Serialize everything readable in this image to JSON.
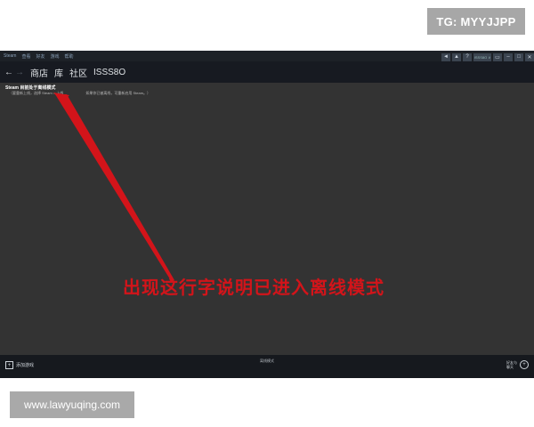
{
  "watermarks": {
    "top_right": "TG: MYYJJPP",
    "bottom_left": "www.lawyuqing.com"
  },
  "steam": {
    "menu": [
      "Steam",
      "查看",
      "好友",
      "游戏",
      "帮助"
    ],
    "nav": {
      "back_icon": "←",
      "forward_icon": "→",
      "items": [
        "商店",
        "库",
        "社区",
        "ISSS8O"
      ]
    },
    "titlebar": {
      "icons": [
        "◄",
        "▲",
        "?"
      ],
      "user": "ISSS8O ∨",
      "window_buttons": [
        "▭",
        "–",
        "□",
        "✕"
      ]
    },
    "content": {
      "offline_title": "Steam 目前处于离线模式",
      "offline_detail": "（要重新上线，选择 Steam > 上线",
      "offline_detail_2": "如果你已被离线，可重新启用 Steam。）"
    },
    "bottom": {
      "add_game": "添加游戏",
      "center_status": "离线模式",
      "friends": "好友与\n聊天"
    }
  },
  "annotation": {
    "text": "出现这行字说明已进入离线模式",
    "color": "#d3141a"
  }
}
